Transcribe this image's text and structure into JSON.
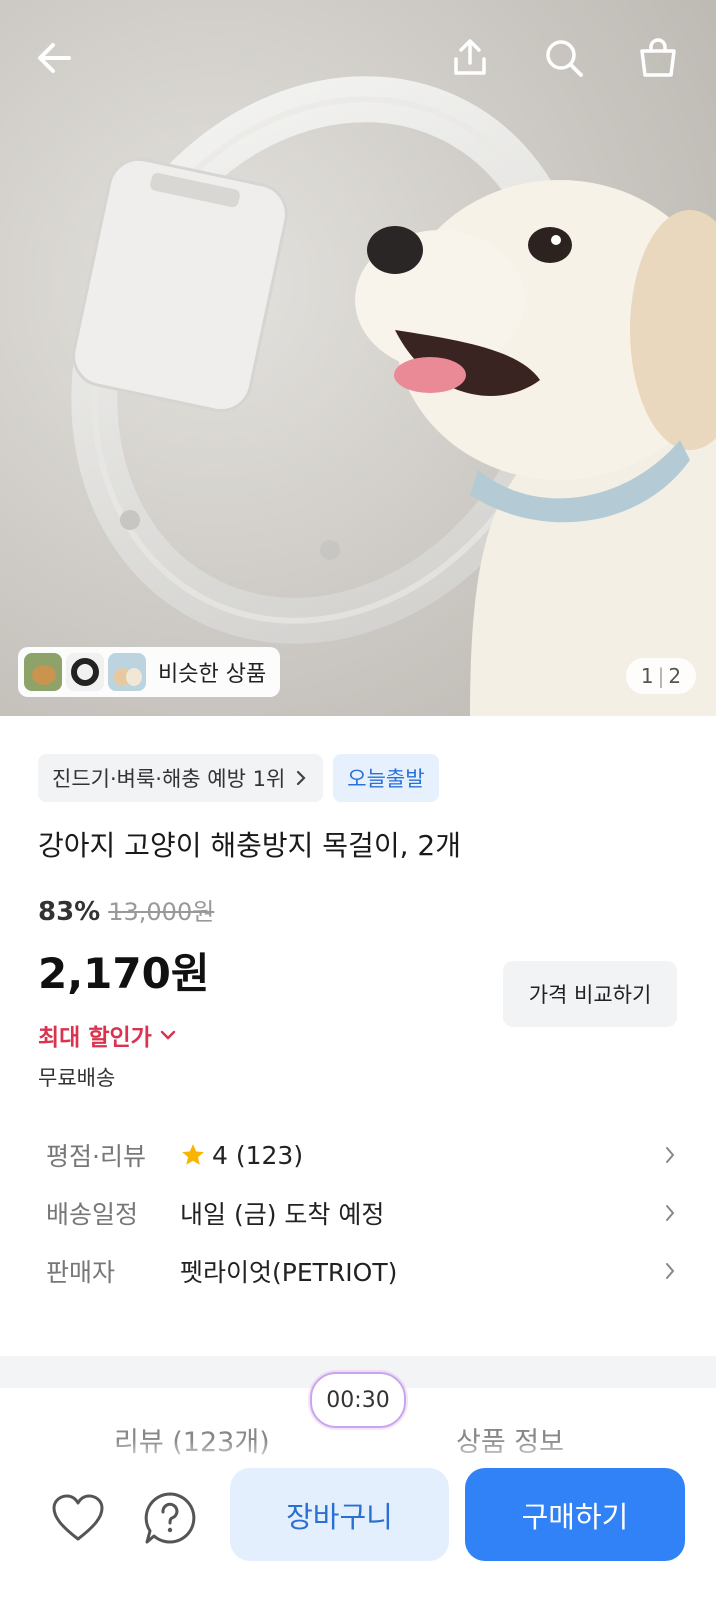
{
  "similar": {
    "label": "비슷한 상품"
  },
  "gallery": {
    "current": "1",
    "total": "2"
  },
  "badges": {
    "rank": "진드기·벼룩·해충 예방 1위",
    "delivery_tag": "오늘출발"
  },
  "product": {
    "title": "강아지 고양이 해충방지 목걸이, 2개",
    "discount": "83%",
    "original_price": "13,000원",
    "price": "2,170원",
    "compare_label": "가격 비교하기",
    "max_discount": "최대 할인가",
    "shipping": "무료배송"
  },
  "details": [
    {
      "label": "평점·리뷰",
      "value": "4 (123)"
    },
    {
      "label": "배송일정",
      "value": "내일 (금) 도착 예정"
    },
    {
      "label": "판매자",
      "value": "펫라이엇(PETRIOT)"
    }
  ],
  "timer": "00:30",
  "tabs": {
    "reviews": "리뷰 (123개)",
    "info": "상품 정보"
  },
  "actions": {
    "cart": "장바구니",
    "buy": "구매하기"
  },
  "colors": {
    "accent": "#3182f6",
    "discount_red": "#d9334f",
    "star": "#f7b500"
  }
}
